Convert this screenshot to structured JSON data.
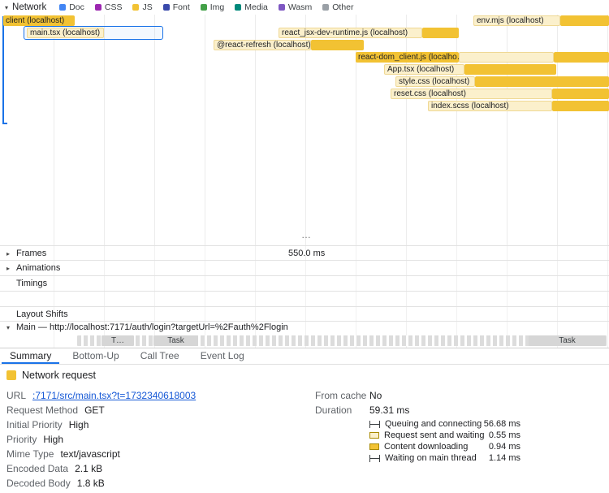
{
  "colors": {
    "js_solid": "#F2C233",
    "js_waiting": "#FBF0CC",
    "selection_blue": "#1A73E8",
    "link_blue": "#1558D6",
    "task_gray": "#D6D6D6"
  },
  "network_track": {
    "name": "Network",
    "legend": [
      {
        "label": "Doc",
        "color": "#4285F4"
      },
      {
        "label": "CSS",
        "color": "#9C27B0"
      },
      {
        "label": "JS",
        "color": "#F2C233"
      },
      {
        "label": "Font",
        "color": "#3949AB"
      },
      {
        "label": "Img",
        "color": "#43A047"
      },
      {
        "label": "Media",
        "color": "#00897B"
      },
      {
        "label": "Wasm",
        "color": "#7E57C2"
      },
      {
        "label": "Other",
        "color": "#9AA0A6"
      }
    ],
    "requests": [
      {
        "label": "client (localhost)"
      },
      {
        "label": "env.mjs (localhost)"
      },
      {
        "label": "main.tsx (localhost)"
      },
      {
        "label": "react_jsx-dev-runtime.js (localhost)"
      },
      {
        "label": "@react-refresh (localhost)"
      },
      {
        "label": "react-dom_client.js (localho…"
      },
      {
        "label": "App.tsx (localhost)"
      },
      {
        "label": "style.css (localhost)"
      },
      {
        "label": "reset.css (localhost)"
      },
      {
        "label": "index.scss (localhost)"
      }
    ],
    "overflow_indicator": "…"
  },
  "tracks": {
    "frames": {
      "label": "Frames",
      "time_label": "550.0 ms"
    },
    "animations": {
      "label": "Animations"
    },
    "timings": {
      "label": "Timings"
    },
    "layout_shifts": {
      "label": "Layout Shifts"
    },
    "main": {
      "label": "Main — http://localhost:7171/auth/login?targetUrl=%2Fauth%2Flogin",
      "tasks": [
        {
          "label": "T…"
        },
        {
          "label": "Task"
        },
        {
          "label": "Task"
        }
      ]
    }
  },
  "tabs": [
    {
      "label": "Summary",
      "active": true
    },
    {
      "label": "Bottom-Up"
    },
    {
      "label": "Call Tree"
    },
    {
      "label": "Event Log"
    }
  ],
  "summary": {
    "title": "Network request",
    "fields_left": [
      {
        "label": "URL",
        "value": ":7171/src/main.tsx?t=1732340618003"
      },
      {
        "label": "Request Method",
        "value": "GET"
      },
      {
        "label": "Initial Priority",
        "value": "High"
      },
      {
        "label": "Priority",
        "value": "High"
      },
      {
        "label": "Mime Type",
        "value": "text/javascript"
      },
      {
        "label": "Encoded Data",
        "value": "2.1 kB"
      },
      {
        "label": "Decoded Body",
        "value": "1.8 kB"
      }
    ],
    "from_cache": {
      "label": "From cache",
      "value": "No"
    },
    "duration": {
      "label": "Duration",
      "value": "59.31 ms"
    },
    "breakdown": [
      {
        "icon": "whisker",
        "label": "Queuing and connecting",
        "value": "56.68 ms"
      },
      {
        "icon": "light-box",
        "label": "Request sent and waiting",
        "value": "0.55 ms"
      },
      {
        "icon": "solid-box",
        "label": "Content downloading",
        "value": "0.94 ms"
      },
      {
        "icon": "whisker",
        "label": "Waiting on main thread",
        "value": "1.14 ms"
      }
    ]
  }
}
